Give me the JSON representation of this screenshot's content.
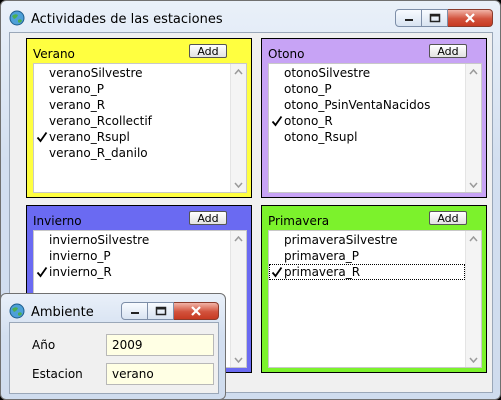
{
  "main_window": {
    "title": "Actividades de las estaciones"
  },
  "panels": [
    {
      "label": "Verano",
      "add_label": "Add",
      "color": "#ffff40",
      "items": [
        {
          "label": "veranoSilvestre",
          "checked": false
        },
        {
          "label": "verano_P",
          "checked": false
        },
        {
          "label": "verano_R",
          "checked": false
        },
        {
          "label": "verano_Rcollectif",
          "checked": false
        },
        {
          "label": "verano_Rsupl",
          "checked": true
        },
        {
          "label": "verano_R_danilo",
          "checked": false
        }
      ]
    },
    {
      "label": "Otono",
      "add_label": "Add",
      "color": "#c7a3f5",
      "items": [
        {
          "label": "otonoSilvestre",
          "checked": false
        },
        {
          "label": "otono_P",
          "checked": false
        },
        {
          "label": "otono_PsinVentaNacidos",
          "checked": false
        },
        {
          "label": "otono_R",
          "checked": true
        },
        {
          "label": "otono_Rsupl",
          "checked": false
        }
      ]
    },
    {
      "label": "Invierno",
      "add_label": "Add",
      "color": "#6a6af2",
      "items": [
        {
          "label": "inviernoSilvestre",
          "checked": false
        },
        {
          "label": "invierno_P",
          "checked": false
        },
        {
          "label": "invierno_R",
          "checked": true
        }
      ]
    },
    {
      "label": "Primavera",
      "add_label": "Add",
      "color": "#7cf22c",
      "items": [
        {
          "label": "primaveraSilvestre",
          "checked": false
        },
        {
          "label": "primavera_P",
          "checked": false
        },
        {
          "label": "primavera_R",
          "checked": true,
          "focused": true
        }
      ]
    }
  ],
  "dialog": {
    "title": "Ambiente",
    "fields": [
      {
        "label": "Año",
        "value": "2009"
      },
      {
        "label": "Estacion",
        "value": "verano"
      }
    ]
  },
  "colors": {
    "input_background": "#ffffe4",
    "close_button": "#c94a33"
  }
}
